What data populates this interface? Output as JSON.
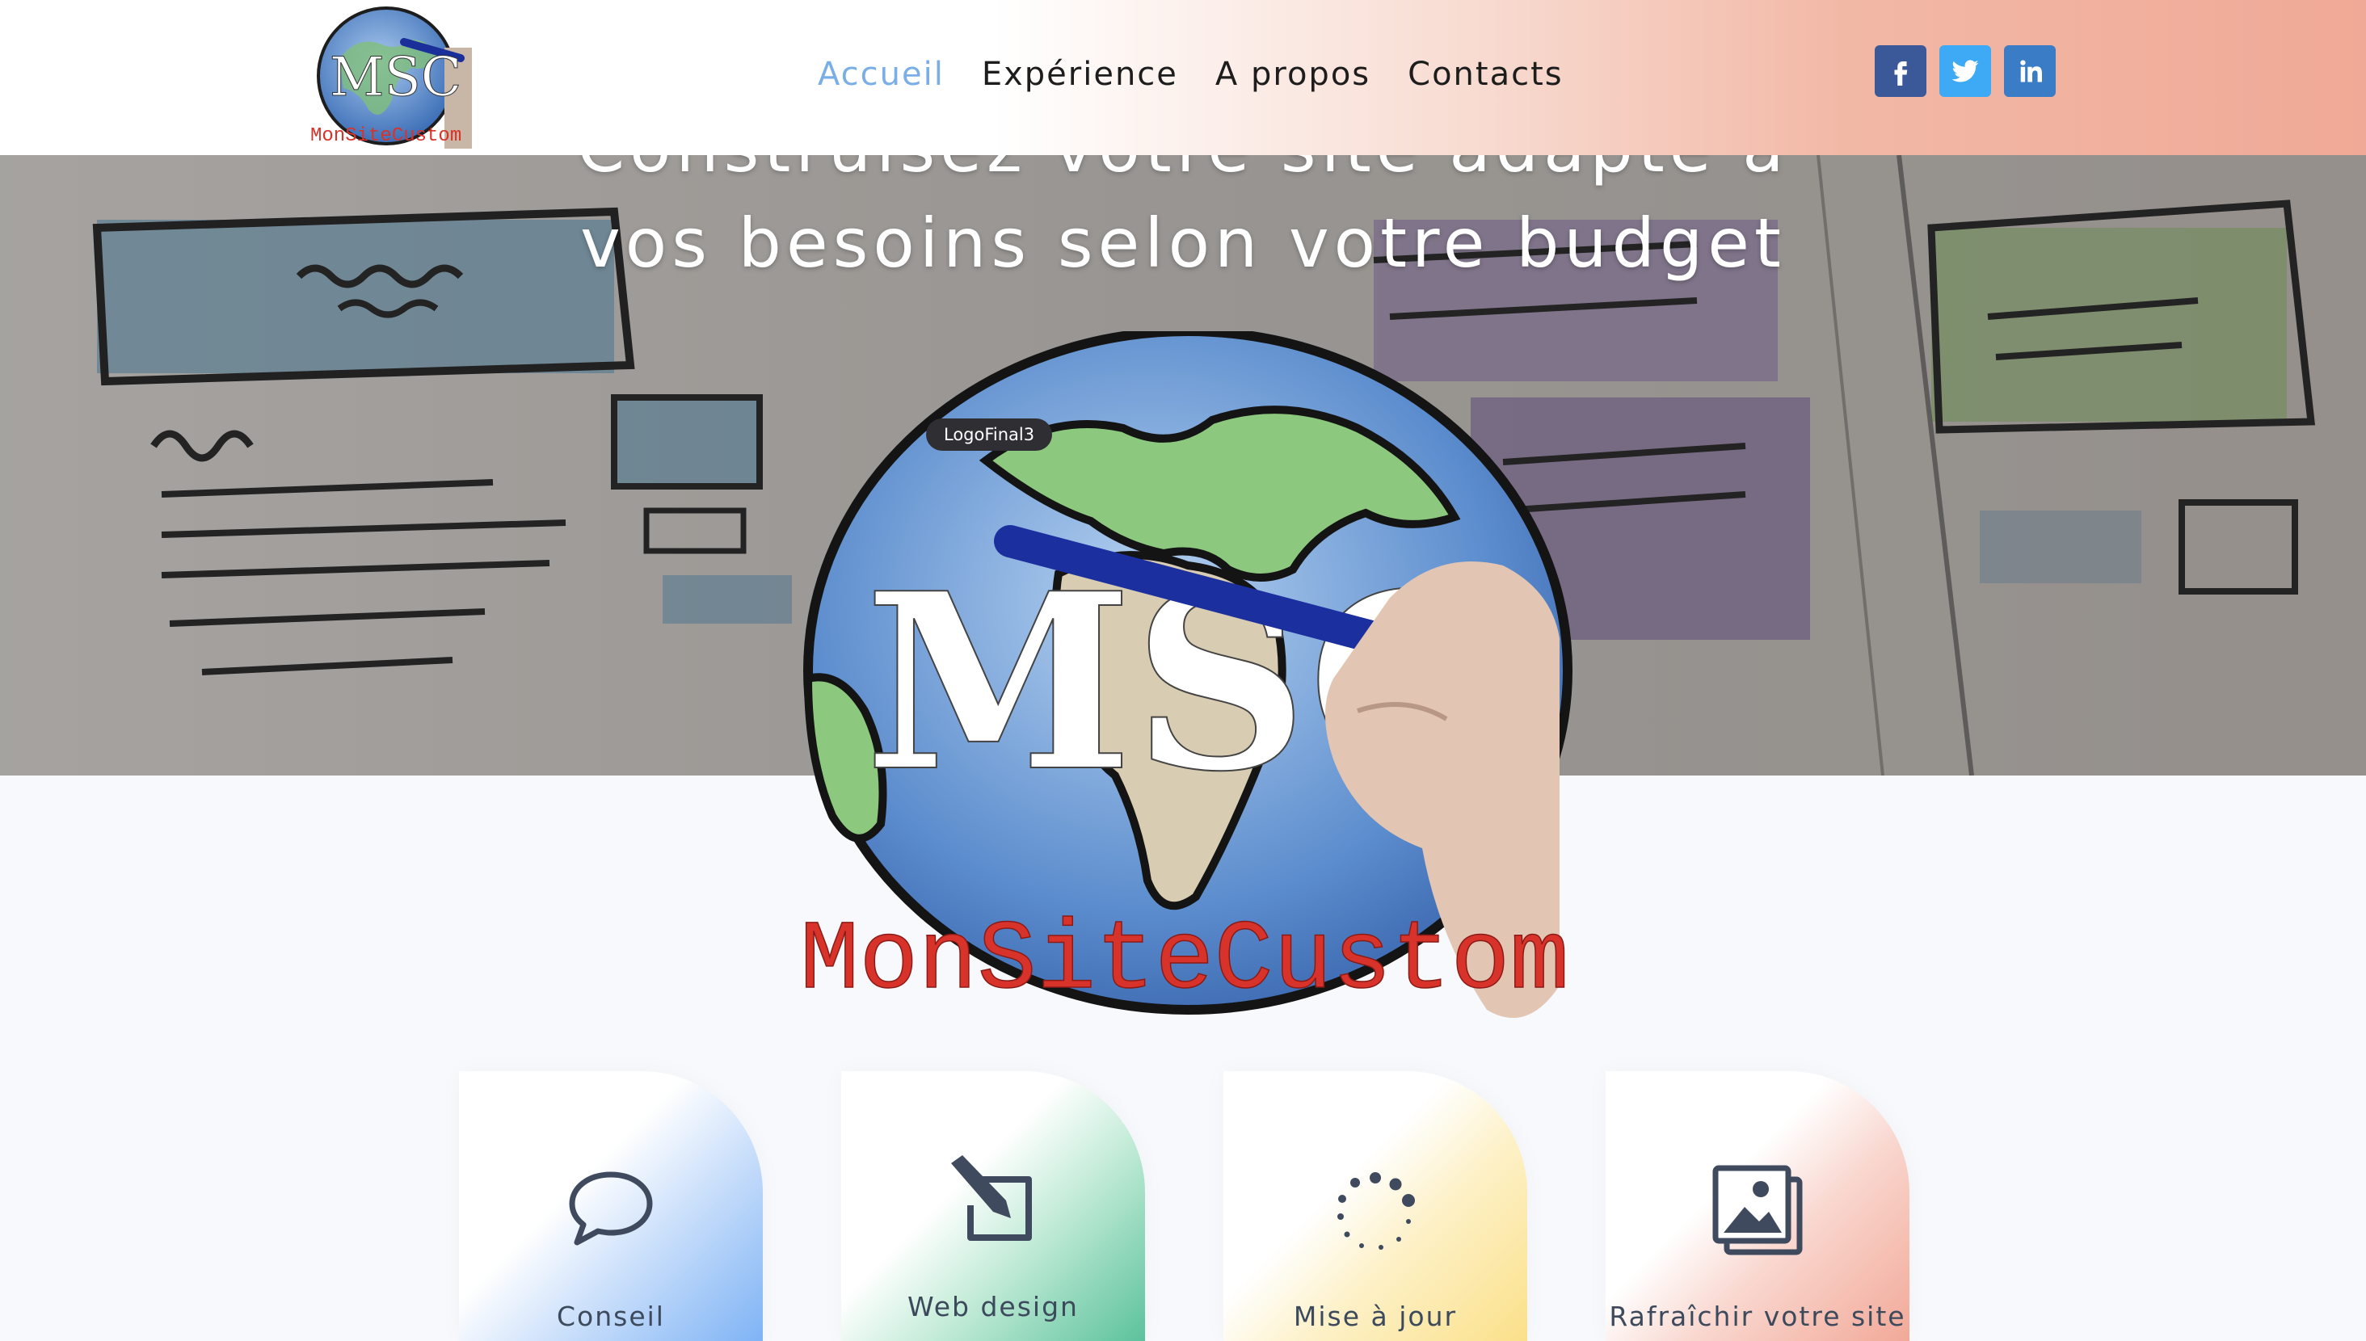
{
  "header": {
    "logo": {
      "text": "MSC",
      "subtext": "MonSiteCustom"
    },
    "nav": [
      {
        "label": "Accueil",
        "active": true
      },
      {
        "label": "Expérience",
        "active": false
      },
      {
        "label": "A propos",
        "active": false
      },
      {
        "label": "Contacts",
        "active": false
      }
    ],
    "social": [
      {
        "name": "facebook",
        "icon": "facebook-icon",
        "glyph": "f",
        "color": "#3b5998"
      },
      {
        "name": "twitter",
        "icon": "twitter-icon",
        "glyph": "t",
        "color": "#3ea9f5"
      },
      {
        "name": "linkedin",
        "icon": "linkedin-icon",
        "glyph": "in",
        "color": "#3a7cc5"
      }
    ]
  },
  "hero": {
    "title_line1": "Construisez votre site adapté à",
    "title_line2": "vos besoins selon votre budget"
  },
  "logo": {
    "text": "MSC",
    "subtext": "MonSiteCustom",
    "tooltip": "LogoFinal3"
  },
  "services": [
    {
      "label": "Conseil",
      "icon": "speech-bubble-icon",
      "accent": "#7fb3f5"
    },
    {
      "label": "Web design",
      "icon": "edit-icon",
      "accent": "#5cc29c"
    },
    {
      "label": "Mise à jour",
      "icon": "loading-icon",
      "accent": "#fbe08a"
    },
    {
      "label": "Rafraîchir votre site",
      "icon": "image-icon",
      "accent": "#f2a998"
    }
  ],
  "colors": {
    "nav_active": "#7aaee6",
    "text_dark": "#1d1d1d",
    "logo_red": "#d8332a"
  }
}
